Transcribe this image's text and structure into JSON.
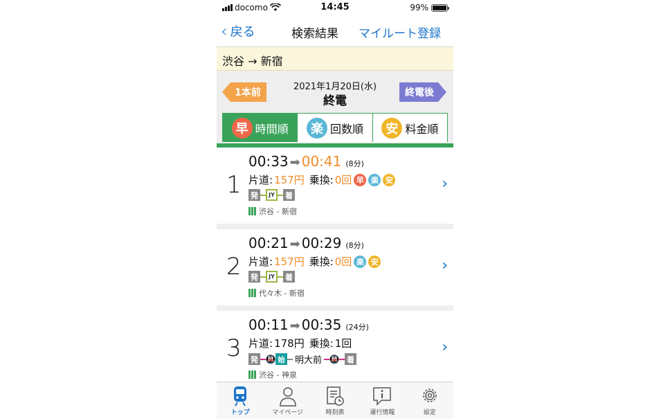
{
  "status": {
    "carrier": "docomo",
    "time": "14:45",
    "battery": "99%"
  },
  "nav": {
    "back": "戻る",
    "title": "検索結果",
    "action": "マイルート登録"
  },
  "route": "渋谷 → 新宿",
  "date": {
    "prev": "1本前",
    "date": "2021年1月20日(水)",
    "sub": "終電",
    "next": "終電後"
  },
  "sort_tabs": [
    {
      "icon": "早",
      "label": "時間順",
      "active": true
    },
    {
      "icon": "楽",
      "label": "回数順"
    },
    {
      "icon": "安",
      "label": "料金順"
    }
  ],
  "results": [
    {
      "num": "1",
      "dep": "00:33",
      "arr": "00:41",
      "dur": "(8分)",
      "fare_label": "片道:",
      "fare": "157円",
      "transfer_label": "乗換:",
      "transfer": "0回",
      "badges": [
        "早",
        "楽",
        "安"
      ],
      "path": {
        "dep": "発",
        "line": "JY",
        "arr": "着"
      },
      "stations": "渋谷 - 新宿"
    },
    {
      "num": "2",
      "dep": "00:21",
      "arr": "00:29",
      "dur": "(8分)",
      "fare_label": "片道:",
      "fare": "157円",
      "transfer_label": "乗換:",
      "transfer": "0回",
      "badges": [
        "楽",
        "安"
      ],
      "path": {
        "dep": "発",
        "line": "JY",
        "arr": "着"
      },
      "stations": "代々木 - 新宿"
    },
    {
      "num": "3",
      "dep": "00:11",
      "arr": "00:35",
      "dur": "(24分)",
      "fare_label": "片道:",
      "fare": "178円",
      "transfer_label": "乗換:",
      "transfer": "1回",
      "badges": [],
      "path": {
        "dep": "発",
        "start": "始",
        "via": "明大前",
        "arr": "着"
      },
      "stations": "渋谷 - 神泉"
    }
  ],
  "tabs": [
    {
      "label": "トップ",
      "icon": "train-icon"
    },
    {
      "label": "マイページ",
      "icon": "person-icon"
    },
    {
      "label": "時刻表",
      "icon": "timetable-icon"
    },
    {
      "label": "運行情報",
      "icon": "info-icon"
    },
    {
      "label": "設定",
      "icon": "gear-icon"
    }
  ],
  "colors": {
    "accent": "#1a73c9",
    "green": "#3aa35a",
    "orange": "#f28c28"
  }
}
